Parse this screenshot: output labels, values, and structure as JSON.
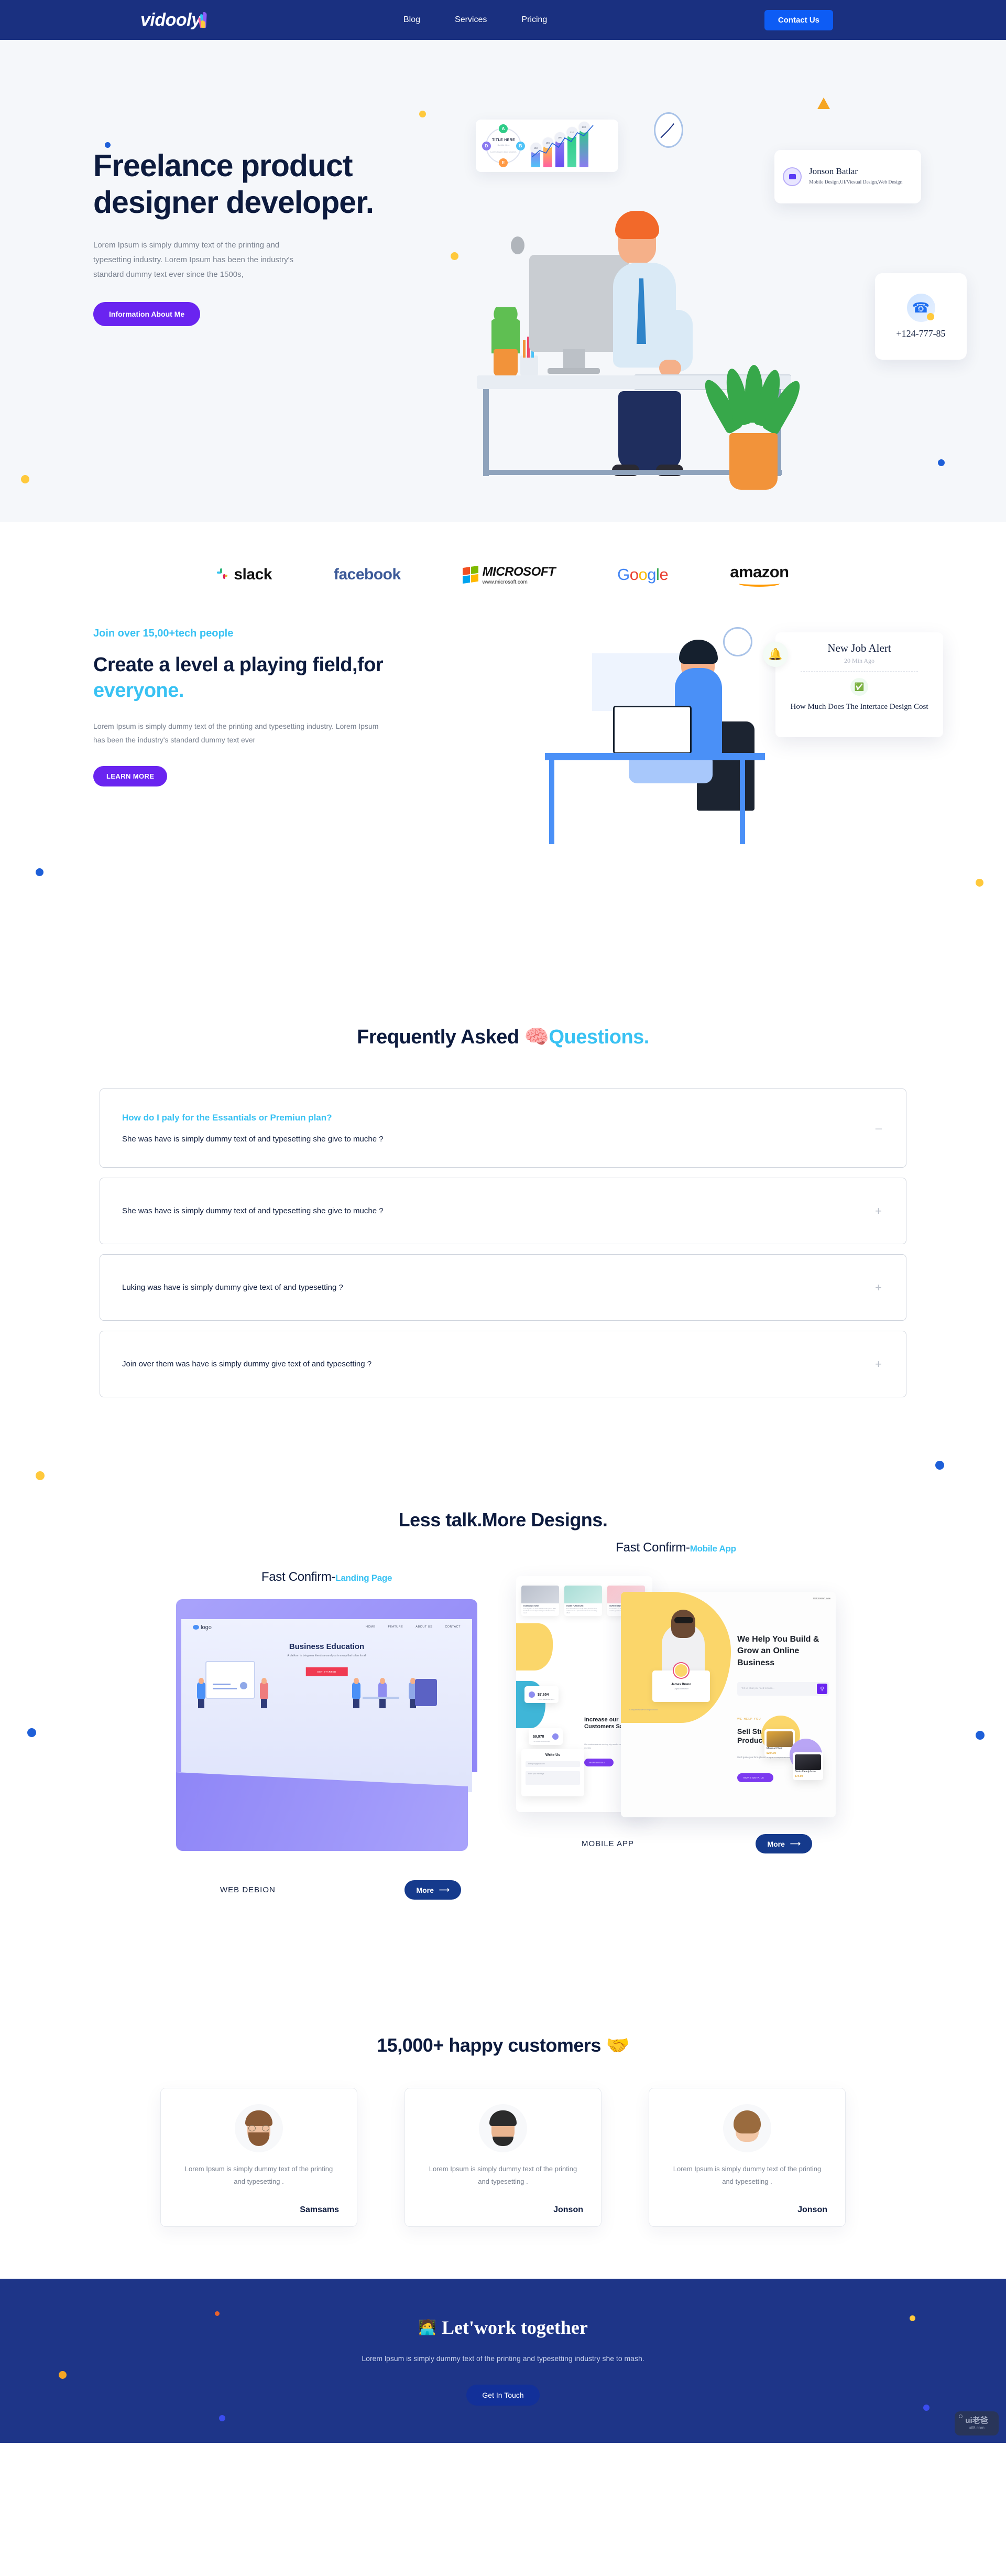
{
  "header": {
    "logo": "vidooly",
    "nav": [
      {
        "label": "Blog"
      },
      {
        "label": "Services"
      },
      {
        "label": "Pricing"
      }
    ],
    "cta": "Contact Us"
  },
  "hero": {
    "title": "Freelance product designer developer.",
    "paragraph": "Lorem Ipsum is simply dummy text of the printing and typesetting industry. Lorem Ipsum has been the industry's standard dummy text ever since the 1500s,",
    "button": "Information About Me",
    "profile_card": {
      "name": "Jonson Batlar",
      "role": "Mobile Design,UI/Viesual Design,Web Design"
    },
    "phone_card": {
      "number": "+124-777-85"
    },
    "chart_card": {
      "title": "TITLE HERE",
      "subtitle": "Subtitle Here",
      "body": "Lorem Ipsum dolor sit amet,",
      "nodes": [
        "A",
        "B",
        "D",
        "E"
      ],
      "bar_labels": [
        "10K",
        "15K",
        "19K",
        "21K",
        "23K"
      ]
    }
  },
  "brands": [
    {
      "name": "slack"
    },
    {
      "name": "facebook"
    },
    {
      "name": "MICROSOFT",
      "sub": "www.microsoft.com"
    },
    {
      "name": "Google"
    },
    {
      "name": "amazon"
    }
  ],
  "level": {
    "eyebrow": "Join over 15,00+tech people",
    "title_part1": "Create a level a playing field,for ",
    "title_accent": "everyone.",
    "paragraph": "Lorem Ipsum is simply dummy text of the printing and typesetting industry. Lorem Ipsum has been the industry's standard dummy text ever",
    "button": "LEARN MORE",
    "job_card": {
      "title": "New Job Alert",
      "time": "20 Min Ago",
      "question": "How Much Does The Intertace Design Cost"
    }
  },
  "faq": {
    "title_part1": "Frequently Asked ",
    "title_accent": "Questions.",
    "emoji": "🧠",
    "items": [
      {
        "question": "How do I paly for the Essantials or Premiun plan?",
        "answer": "She was have  is simply dummy text of and typesetting she give to muche ?",
        "toggle": "–",
        "open": true
      },
      {
        "text": "She was have  is simply dummy text of and typesetting she give to muche ?",
        "toggle": "+",
        "open": false
      },
      {
        "text": "Luking was have  is simply dummy  give text of and typesetting ?",
        "toggle": "+",
        "open": false
      },
      {
        "text": "Join over them  was have  is simply dummy  give text of and typesetting ?",
        "toggle": "+",
        "open": false
      }
    ]
  },
  "designs": {
    "title": "Less talk.More Designs.",
    "landing": {
      "label_main": "Fast Confirm-",
      "label_accent": "Landing Page",
      "tag": "WEB DEBION",
      "more": "More",
      "mock": {
        "logo": "logo",
        "nav": [
          "HOME",
          "FEATURE",
          "ABOUT US",
          "CONTACT"
        ],
        "title": "Business Education",
        "subtitle": "A platform to bring new friends around you in a way that is fun for all",
        "cta": "GET STARTED"
      }
    },
    "mobile": {
      "label_main": "Fast Confirm-",
      "label_accent": "Mobile App",
      "tag": "MOBILE APP",
      "more": "More",
      "mock": {
        "hero_title": "We Help You Build & Grow an Online Business",
        "search_placeholder": "Tell us what you need to build...",
        "person_name": "James Bruno",
        "person_role": "Digital Marketer",
        "companies_note": "Companies we've helped build",
        "sell_eyebrow": "WE HELP YOU",
        "sell_title": "Sell Stunning Products",
        "sell_paragraph": "We'll guide you through our unique 5-step brand-building framework",
        "sell_cta": "MORE DETAILS",
        "products": [
          {
            "name": "Minimal Chair",
            "price": "$204.00"
          },
          {
            "name": "Beats Headphone",
            "price": "$74.00"
          }
        ],
        "increase_title": "Increase our Customers Sales",
        "increase_paragraph": "Our customers are seeing big results on their first three months",
        "increase_cta": "MORE DETAILS",
        "stats": [
          {
            "value": "$7,654",
            "label": "TOTAL REVENUE 2019"
          },
          {
            "value": "$9,978",
            "label": "TOTAL REVENUE 2020"
          }
        ],
        "tiles": [
          {
            "name": "FASHION STORE",
            "desc": "Look stylish & on trend at fashionable prices. With hundreds of new styles hitting our shelves every week"
          },
          {
            "name": "HOME FURNITURE",
            "desc": "From bookcases to comfy chairs, furniture and mattresses at a price that customers can easily afford"
          },
          {
            "name": "SUPER GADGET STORE",
            "desc": "A must have on any road trip, gifts and gadgets, outdoor gear and tech toys"
          }
        ],
        "write_us": "Write Us",
        "write_email": "example@gmail.com",
        "write_msg": "Enter your message",
        "get_started": "Get Started Now"
      }
    }
  },
  "testimonials": {
    "title": "15,000+ happy customers",
    "emoji": "🤝",
    "cards": [
      {
        "text": "Lorem Ipsum is simply dummy text of the printing and typesetting .",
        "name": "Samsams"
      },
      {
        "text": "Lorem Ipsum is simply dummy text of the printing and typesetting .",
        "name": "Jonson"
      },
      {
        "text": "Lorem Ipsum is simply dummy text of the printing and typesetting .",
        "name": "Jonson"
      }
    ]
  },
  "footer": {
    "title": "Let'work together",
    "emoji": "🧑‍💻",
    "paragraph": "Lorem lpsum is simply dummy text of the printing and typesetting industry she to mash.",
    "button": "Get In Touch"
  },
  "watermark": {
    "top": "ui老爸",
    "bottom": "uil8.com"
  },
  "colors": {
    "navy": "#1a3080",
    "blue": "#0d5cf5",
    "purple": "#6a24f0",
    "cyan": "#39c2f3",
    "dark": "#0d1b3e"
  }
}
